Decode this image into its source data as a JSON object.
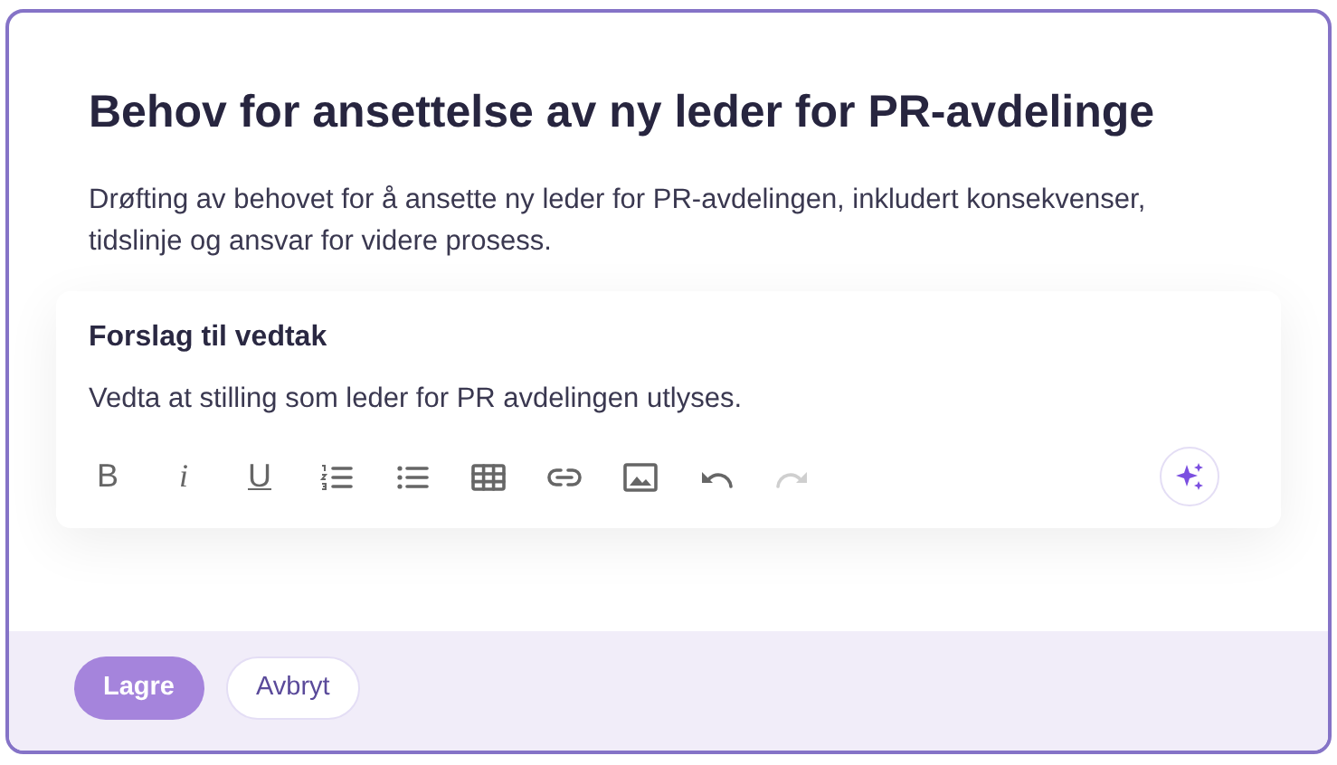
{
  "title": "Behov for ansettelse av ny leder for PR-avdelinge",
  "description": "Drøfting av behovet for å ansette ny leder for PR-avdelingen, inkludert konsekvenser, tidslinje og ansvar for videre prosess.",
  "editor": {
    "label": "Forslag til vedtak",
    "value": "Vedta at stilling som leder for PR avdelingen utlyses.",
    "toolbar": [
      {
        "kind": "bold",
        "text": "B",
        "disabled": false
      },
      {
        "kind": "italic",
        "text": "i",
        "disabled": false
      },
      {
        "kind": "underline",
        "text": "U",
        "disabled": false
      },
      {
        "kind": "ordered-list",
        "disabled": false
      },
      {
        "kind": "bullet-list",
        "disabled": false
      },
      {
        "kind": "table",
        "disabled": false
      },
      {
        "kind": "link",
        "disabled": false
      },
      {
        "kind": "image",
        "disabled": false
      },
      {
        "kind": "undo",
        "disabled": false
      },
      {
        "kind": "redo",
        "disabled": true
      }
    ]
  },
  "buttons": [
    {
      "label": "Lagre",
      "kind": "primary"
    },
    {
      "label": "Avbryt",
      "kind": "secondary"
    }
  ]
}
